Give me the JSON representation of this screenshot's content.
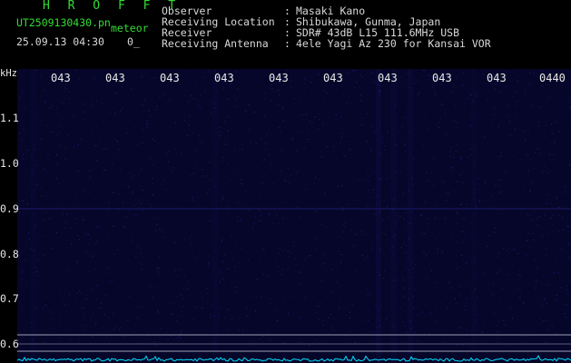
{
  "header": {
    "title": "H R O F F T",
    "filename": "UT2509130430.pn",
    "tag": "meteor",
    "datetime": "25.09.13 04:30",
    "count": "0_",
    "info": [
      {
        "label": "Observer",
        "value": "Masaki Kano"
      },
      {
        "label": "Receiving Location",
        "value": "Shibukawa, Gunma, Japan"
      },
      {
        "label": "Receiver",
        "value": "SDR# 43dB L15 111.6MHz USB"
      },
      {
        "label": "Receiving Antenna",
        "value": "4ele Yagi Az 230 for Kansai VOR"
      }
    ],
    "separator": ":"
  },
  "plot": {
    "unit": "kHz",
    "time_ticks": [
      "043",
      "043",
      "043",
      "043",
      "043",
      "043",
      "043",
      "043",
      "043",
      "0440"
    ],
    "freq_ticks": [
      "1.1",
      "1.0",
      "0.9",
      "0.8",
      "0.7",
      "0.6"
    ],
    "colors": {
      "background": "#06062a",
      "noise": "#2a2a9a",
      "signal": "#00e0ff",
      "grid": "#b0b0c8"
    }
  }
}
